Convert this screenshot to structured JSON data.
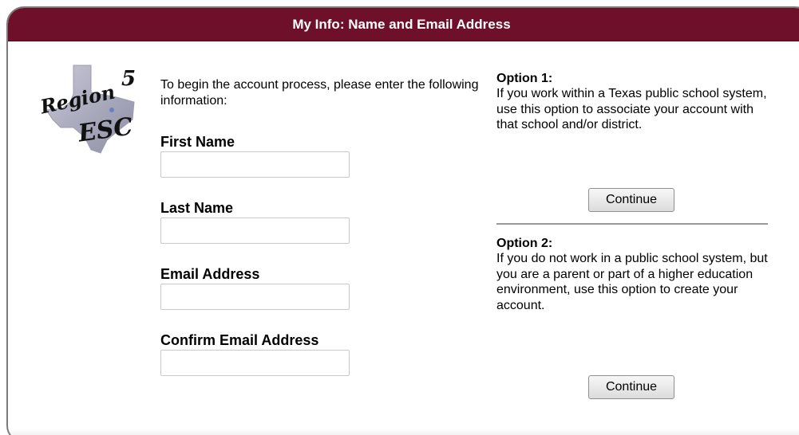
{
  "header": {
    "title": "My Info: Name and Email Address"
  },
  "logo": {
    "line1": "Region",
    "number": "5",
    "line2": "ESC"
  },
  "form": {
    "intro": "To begin the account process, please enter the following information:",
    "first_name_label": "First Name",
    "first_name_value": "",
    "last_name_label": "Last Name",
    "last_name_value": "",
    "email_label": "Email Address",
    "email_value": "",
    "confirm_email_label": "Confirm Email Address",
    "confirm_email_value": ""
  },
  "options": {
    "option1_title": "Option 1:",
    "option1_desc": "If you work within a Texas public school system, use this option to associate your account with that school and/or district.",
    "option1_button": "Continue",
    "option2_title": "Option 2:",
    "option2_desc": "If you do not work in a public school system, but you are a parent or part of a higher education environment, use this option to create your account.",
    "option2_button": "Continue"
  },
  "colors": {
    "header_bg": "#6e1029",
    "header_text": "#ffffff"
  }
}
